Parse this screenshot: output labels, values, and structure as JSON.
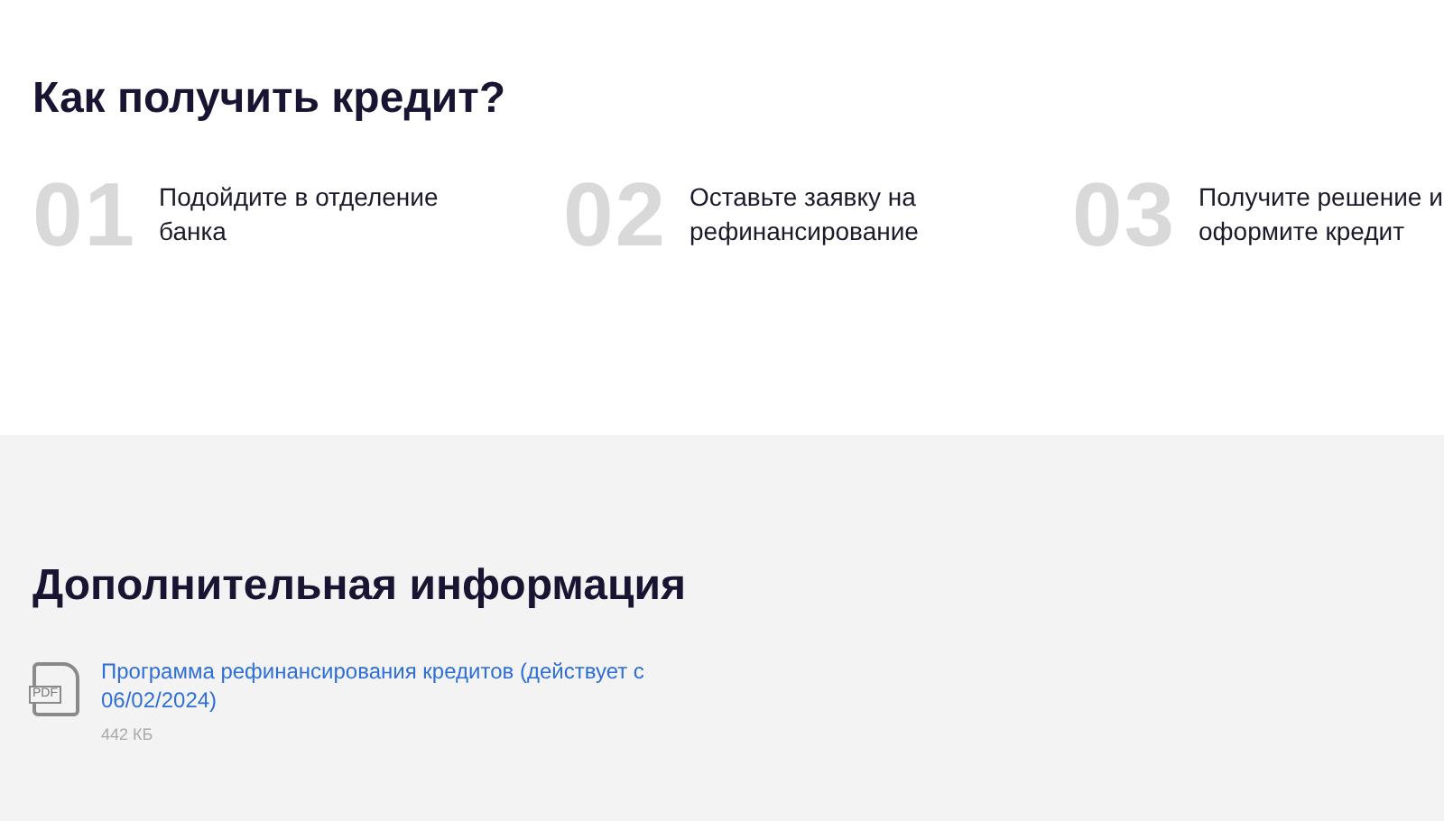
{
  "steps_section": {
    "title": "Как получить кредит?",
    "steps": [
      {
        "number": "01",
        "text": "Подойдите в отделение банка"
      },
      {
        "number": "02",
        "text": "Оставьте заявку на рефинансирование"
      },
      {
        "number": "03",
        "text": "Получите решение и оформите кредит"
      }
    ]
  },
  "info_section": {
    "title": "Дополнительная информация",
    "documents": [
      {
        "icon_label": "PDF",
        "title": "Программа рефинансирования кредитов (действует с 06/02/2024)",
        "size": "442 КБ"
      }
    ]
  }
}
